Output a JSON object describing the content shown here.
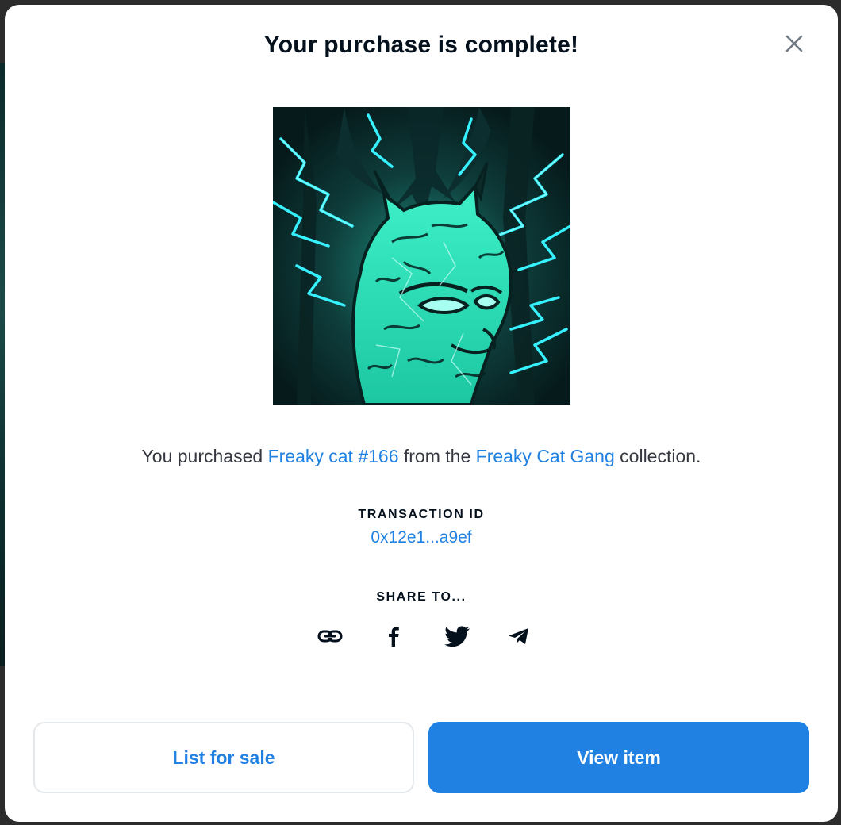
{
  "modal": {
    "title": "Your purchase is complete!",
    "close_icon": "close-icon"
  },
  "item": {
    "image_icon": "nft-artwork-cyan-cat",
    "sentence_prefix": "You purchased ",
    "item_name": "Freaky cat #166",
    "sentence_middle": " from the ",
    "collection_name": "Freaky Cat Gang",
    "sentence_suffix": " collection."
  },
  "transaction": {
    "label": "TRANSACTION ID",
    "id": "0x12e1...a9ef"
  },
  "share": {
    "label": "SHARE TO...",
    "icons": [
      "link-icon",
      "facebook-icon",
      "twitter-icon",
      "telegram-icon"
    ]
  },
  "buttons": {
    "list_for_sale": "List for sale",
    "view_item": "View item"
  },
  "colors": {
    "accent": "#2081e2",
    "title_text": "#04111d",
    "body_text": "#353840",
    "button_border": "#e5e8eb",
    "artwork_primary": "#2ee6c0",
    "artwork_dark": "#0a2a2a"
  }
}
